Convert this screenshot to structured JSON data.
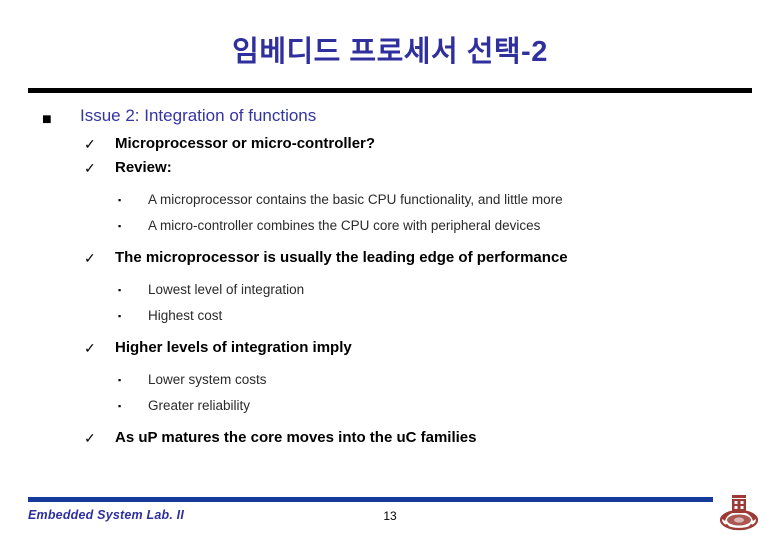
{
  "slide": {
    "title": "임베디드 프로세서 선택-2",
    "title_color": "#2f2f9e",
    "rule_color": "#000000"
  },
  "outline": [
    {
      "level": 1,
      "bullet": "square-bullet-blue",
      "bullet_glyph": "■",
      "text": "Issue 2: Integration of functions"
    },
    {
      "level": 2,
      "bullet": "checkmark-bullet",
      "bullet_glyph": "ü",
      "text": "Microprocessor or micro-controller?"
    },
    {
      "level": 2,
      "bullet": "checkmark-bullet",
      "bullet_glyph": "ü",
      "text": "Review:"
    },
    {
      "level": 3,
      "bullet": "small-square-bullet",
      "bullet_glyph": "§",
      "text": "A microprocessor contains the basic CPU functionality, and little more"
    },
    {
      "level": 3,
      "bullet": "small-square-bullet",
      "bullet_glyph": "§",
      "text": "A micro-controller combines the CPU core with peripheral devices"
    },
    {
      "level": 2,
      "bullet": "checkmark-bullet",
      "bullet_glyph": "ü",
      "text": "The microprocessor is usually the leading edge of performance"
    },
    {
      "level": 3,
      "bullet": "small-square-bullet",
      "bullet_glyph": "§",
      "text": "Lowest level of integration"
    },
    {
      "level": 3,
      "bullet": "small-square-bullet",
      "bullet_glyph": "§",
      "text": "Highest cost"
    },
    {
      "level": 2,
      "bullet": "checkmark-bullet",
      "bullet_glyph": "ü",
      "text": "Higher levels of integration imply"
    },
    {
      "level": 3,
      "bullet": "small-square-bullet",
      "bullet_glyph": "§",
      "text": "Lower system costs"
    },
    {
      "level": 3,
      "bullet": "small-square-bullet",
      "bullet_glyph": "§",
      "text": "Greater reliability"
    },
    {
      "level": 2,
      "bullet": "checkmark-bullet",
      "bullet_glyph": "ü",
      "text": "As uP matures the core moves into the uC families"
    }
  ],
  "footer": {
    "lab_label": "Embedded System Lab. II",
    "page_number": "13",
    "rule_color": "#143a9c",
    "label_color": "#2f2f9e",
    "logo_name": "university-emblem-logo",
    "logo_color": "#9c3b35"
  }
}
